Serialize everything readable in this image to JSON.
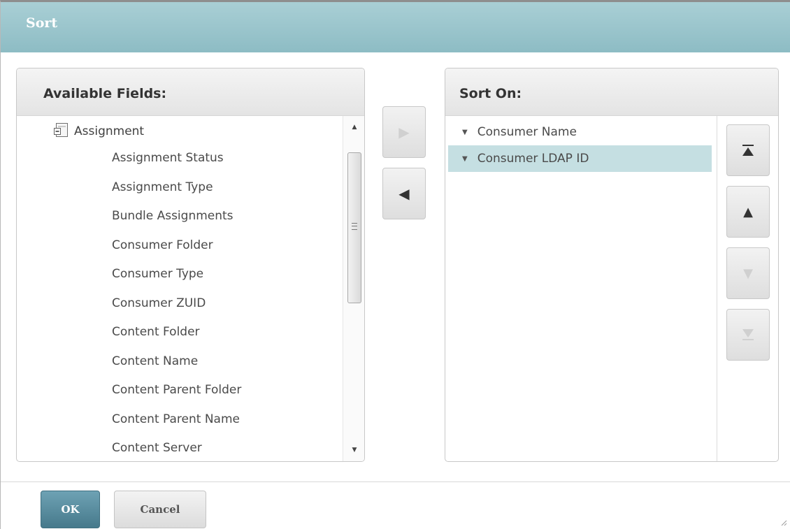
{
  "dialog": {
    "title": "Sort"
  },
  "available": {
    "header": "Available Fields:",
    "root_icon": "folder-tree-icon",
    "root_label": "Assignment",
    "items": [
      "Assignment Status",
      "Assignment Type",
      "Bundle Assignments",
      "Consumer Folder",
      "Consumer Type",
      "Consumer ZUID",
      "Content Folder",
      "Content Name",
      "Content Parent Folder",
      "Content Parent Name",
      "Content Server"
    ]
  },
  "move_buttons": {
    "add_icon": "triangle-right-icon",
    "remove_icon": "triangle-left-icon"
  },
  "sort_on": {
    "header": "Sort On:",
    "items": [
      {
        "label": "Consumer Name",
        "direction_icon": "sort-descending-icon",
        "selected": false
      },
      {
        "label": "Consumer LDAP ID",
        "direction_icon": "sort-descending-icon",
        "selected": true
      }
    ]
  },
  "order_buttons": {
    "top_icon": "move-to-top-icon",
    "up_icon": "move-up-icon",
    "down_icon": "move-down-icon",
    "bottom_icon": "move-to-bottom-icon"
  },
  "footer": {
    "ok_label": "OK",
    "cancel_label": "Cancel"
  },
  "colors": {
    "titlebar": "#9ec6cd",
    "selected_row": "#c5dfe2",
    "ok_button": "#5a8c9e"
  }
}
